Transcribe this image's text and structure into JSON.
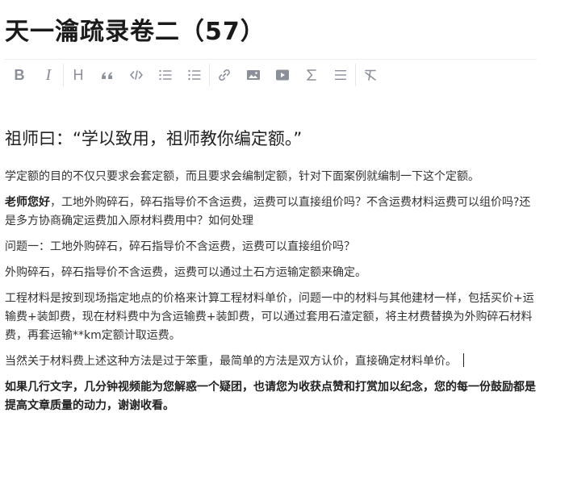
{
  "editor": {
    "title": "天一瀹疏录卷二（57）",
    "toolbar": [
      {
        "name": "bold-button",
        "icon": "bold-icon",
        "glyph": "B"
      },
      {
        "name": "italic-button",
        "icon": "italic-icon",
        "glyph": "I"
      },
      {
        "sep": true
      },
      {
        "name": "heading-button",
        "icon": "heading-icon",
        "glyph": "H"
      },
      {
        "name": "quote-button",
        "icon": "quote-icon"
      },
      {
        "name": "code-button",
        "icon": "code-icon"
      },
      {
        "name": "ordered-list-button",
        "icon": "ordered-list-icon"
      },
      {
        "name": "bullet-list-button",
        "icon": "bullet-list-icon"
      },
      {
        "sep": true
      },
      {
        "name": "link-button",
        "icon": "link-icon"
      },
      {
        "name": "image-button",
        "icon": "image-icon"
      },
      {
        "name": "video-button",
        "icon": "video-icon"
      },
      {
        "name": "formula-button",
        "icon": "sigma-icon"
      },
      {
        "name": "divider-button",
        "icon": "divider-icon"
      },
      {
        "sep": true
      },
      {
        "name": "clear-format-button",
        "icon": "clear-format-icon"
      }
    ]
  },
  "article": {
    "subtitle": "祖师曰：“学以致用，祖师教你编定额。”",
    "p1": "学定额的目的不仅只要求会套定额，而且要求会编制定额，针对下面案例就编制一下这个定额。",
    "p2_bold": "老师您好",
    "p2_rest": "，工地外购碎石，碎石指导价不含运费，运费可以直接组价吗？不含运费材料运费可以组价吗?还是多方协商确定运费加入原材料费用中？如何处理",
    "p3": "问题一：工地外购碎石，碎石指导价不含运费，运费可以直接组价吗？",
    "p4": "外购碎石，碎石指导价不含运费，运费可以通过土石方运输定额来确定。",
    "p5": "工程材料是按到现场指定地点的价格来计算工程材料单价，问题一中的材料与其他建材一样，包括买价+运输费+装卸费，现在材料费中为含运输费+装卸费，可以通过套用石渣定额，将主材费替换为外购碎石材料费，再套运输**km定额计取运费。",
    "p6": "当然关于材料费上述这种方法是过于笨重，最简单的方法是双方认价，直接确定材料单价。",
    "p7": "如果几行文字，几分钟视频能为您解惑一个疑团，也请您为收获点赞和打赏加以纪念，您的每一份鼓励都是提高文章质量的动力，谢谢收看。"
  }
}
